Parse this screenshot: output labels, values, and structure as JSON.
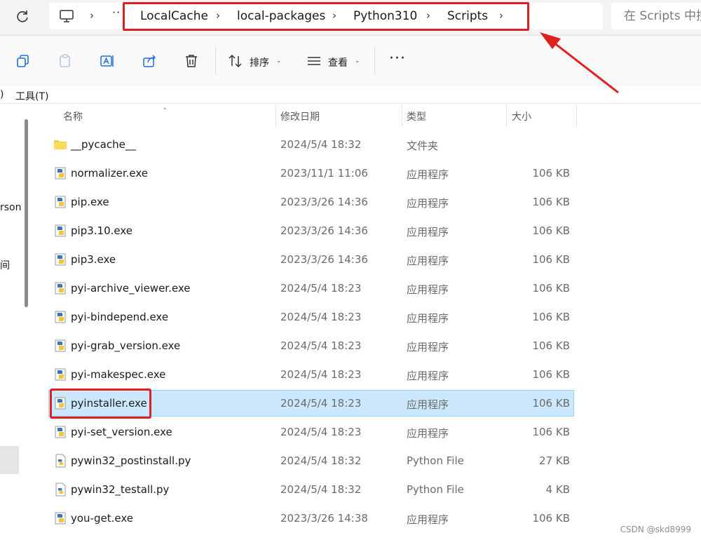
{
  "address_bar": {
    "breadcrumbs": [
      "LocalCache",
      "local-packages",
      "Python310",
      "Scripts"
    ],
    "search_placeholder": "在 Scripts 中搜"
  },
  "toolbar": {
    "sort_label": "排序",
    "view_label": "查看"
  },
  "menubar": {
    "partial": ")",
    "tools": "工具(T)"
  },
  "navpane": {
    "item1": "rson",
    "item2": "间"
  },
  "columns": {
    "name": "名称",
    "modified": "修改日期",
    "type": "类型",
    "size": "大小"
  },
  "files": [
    {
      "name": "__pycache__",
      "modified": "2024/5/4 18:32",
      "type": "文件夹",
      "size": "",
      "icon": "folder-icon"
    },
    {
      "name": "normalizer.exe",
      "modified": "2023/11/1 11:06",
      "type": "应用程序",
      "size": "106 KB",
      "icon": "python-exe-icon"
    },
    {
      "name": "pip.exe",
      "modified": "2023/3/26 14:36",
      "type": "应用程序",
      "size": "106 KB",
      "icon": "python-exe-icon"
    },
    {
      "name": "pip3.10.exe",
      "modified": "2023/3/26 14:36",
      "type": "应用程序",
      "size": "106 KB",
      "icon": "python-exe-icon"
    },
    {
      "name": "pip3.exe",
      "modified": "2023/3/26 14:36",
      "type": "应用程序",
      "size": "106 KB",
      "icon": "python-exe-icon"
    },
    {
      "name": "pyi-archive_viewer.exe",
      "modified": "2024/5/4 18:23",
      "type": "应用程序",
      "size": "106 KB",
      "icon": "python-exe-icon"
    },
    {
      "name": "pyi-bindepend.exe",
      "modified": "2024/5/4 18:23",
      "type": "应用程序",
      "size": "106 KB",
      "icon": "python-exe-icon"
    },
    {
      "name": "pyi-grab_version.exe",
      "modified": "2024/5/4 18:23",
      "type": "应用程序",
      "size": "106 KB",
      "icon": "python-exe-icon"
    },
    {
      "name": "pyi-makespec.exe",
      "modified": "2024/5/4 18:23",
      "type": "应用程序",
      "size": "106 KB",
      "icon": "python-exe-icon"
    },
    {
      "name": "pyinstaller.exe",
      "modified": "2024/5/4 18:23",
      "type": "应用程序",
      "size": "106 KB",
      "icon": "python-exe-icon",
      "selected": true
    },
    {
      "name": "pyi-set_version.exe",
      "modified": "2024/5/4 18:23",
      "type": "应用程序",
      "size": "106 KB",
      "icon": "python-exe-icon"
    },
    {
      "name": "pywin32_postinstall.py",
      "modified": "2024/5/4 18:32",
      "type": "Python File",
      "size": "27 KB",
      "icon": "python-file-icon"
    },
    {
      "name": "pywin32_testall.py",
      "modified": "2024/5/4 18:32",
      "type": "Python File",
      "size": "4 KB",
      "icon": "python-file-icon"
    },
    {
      "name": "you-get.exe",
      "modified": "2023/3/26 14:38",
      "type": "应用程序",
      "size": "106 KB",
      "icon": "python-exe-icon"
    }
  ],
  "watermark": "CSDN @skd8999",
  "colors": {
    "selection_bg": "#cce8ff",
    "annotation_red": "#e02020"
  }
}
